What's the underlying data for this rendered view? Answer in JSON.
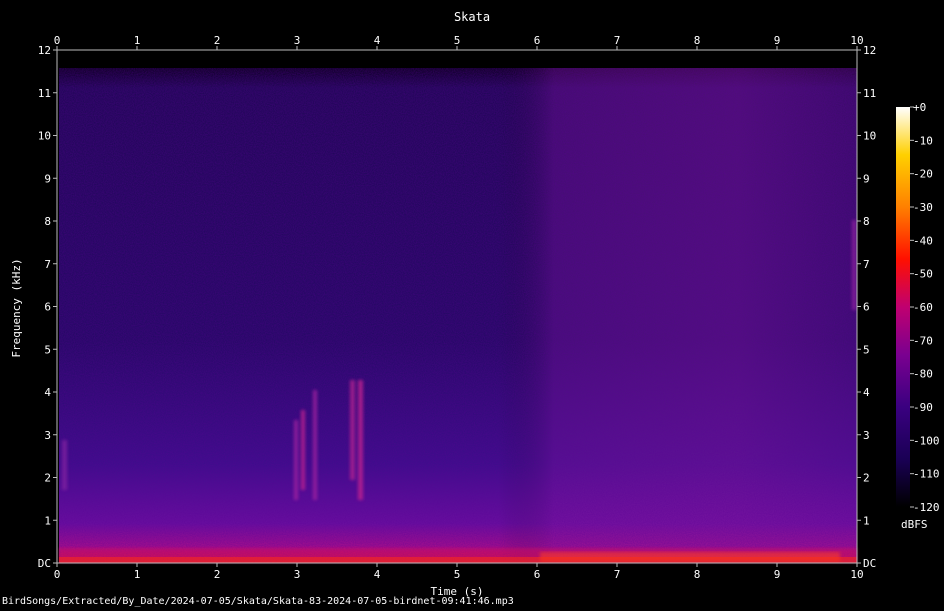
{
  "chart_data": {
    "type": "heatmap",
    "title": "Skata",
    "xlabel": "Time (s)",
    "ylabel": "Frequency (kHz)",
    "xlim": [
      0,
      10
    ],
    "ylim": [
      0,
      12
    ],
    "x_ticks": [
      "0",
      "1",
      "2",
      "3",
      "4",
      "5",
      "6",
      "7",
      "8",
      "9",
      "10"
    ],
    "y_ticks": [
      "DC",
      "1",
      "2",
      "3",
      "4",
      "5",
      "6",
      "7",
      "8",
      "9",
      "10",
      "11",
      "12"
    ],
    "colorbar": {
      "label": "dBFS",
      "range": [
        -120,
        0
      ],
      "ticks": [
        "+0",
        "-10",
        "-20",
        "-30",
        "-40",
        "-50",
        "-60",
        "-70",
        "-80",
        "-90",
        "-100",
        "-110",
        "-120"
      ],
      "colors": [
        "#000000",
        "#1a0055",
        "#3a0080",
        "#7a0090",
        "#c00070",
        "#ff1000",
        "#ff8000",
        "#ffd000",
        "#ffffff"
      ]
    },
    "grid": false
  },
  "footer_text": "BirdSongs/Extracted/By_Date/2024-07-05/Skata/Skata-83-2024-07-05-birdnet-09:41:46.mp3"
}
